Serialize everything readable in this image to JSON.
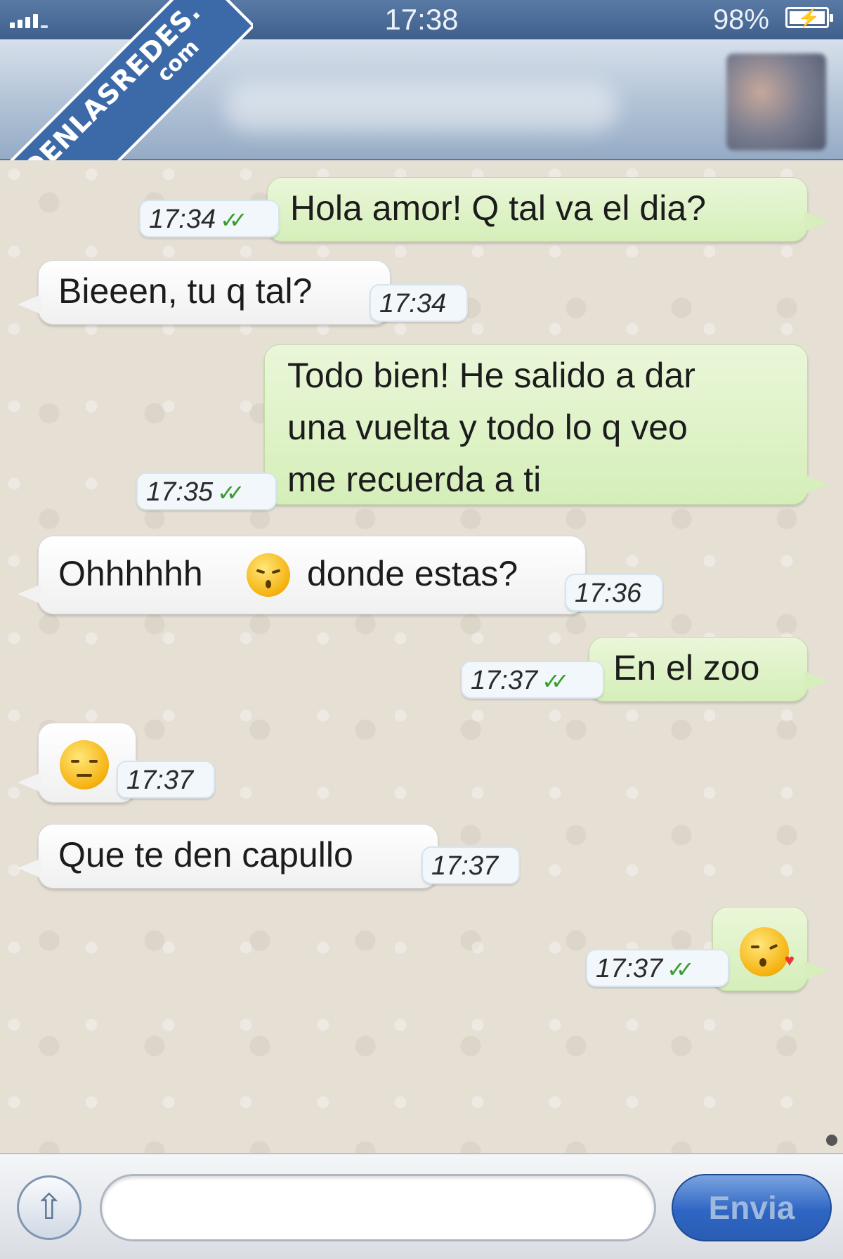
{
  "status_bar": {
    "time": "17:38",
    "battery": "98%"
  },
  "watermark": {
    "line1": "VISTOENLASREDES.",
    "line2": "com"
  },
  "messages": [
    {
      "dir": "out",
      "lines": [
        "Hola amor! Q tal va el dia?"
      ],
      "time": "17:34",
      "ticks": "✓✓"
    },
    {
      "dir": "in",
      "lines": [
        "Bieeen, tu q tal?"
      ],
      "time": "17:34"
    },
    {
      "dir": "out",
      "lines": [
        "Todo bien! He salido a dar",
        "una vuelta y todo lo q veo",
        "me recuerda a ti"
      ],
      "time": "17:35",
      "ticks": "✓✓"
    },
    {
      "dir": "in",
      "text_before": "Ohhhhhh",
      "emoji": "kissing-face-emoji",
      "text_after": "donde estas?",
      "time": "17:36"
    },
    {
      "dir": "out",
      "lines": [
        "En el zoo"
      ],
      "time": "17:37",
      "ticks": "✓✓"
    },
    {
      "dir": "in",
      "emoji": "unamused-face-emoji",
      "time": "17:37"
    },
    {
      "dir": "in",
      "lines": [
        "Que te den capullo"
      ],
      "time": "17:37"
    },
    {
      "dir": "out",
      "emoji": "face-blowing-kiss-emoji",
      "time": "17:37",
      "ticks": "✓✓"
    }
  ],
  "input": {
    "placeholder": ""
  },
  "send_label": "Envia",
  "colors": {
    "outgoing": "#dcf2c4",
    "incoming": "#ffffff",
    "tick": "#3a9c2e",
    "send": "#2f66c4"
  }
}
